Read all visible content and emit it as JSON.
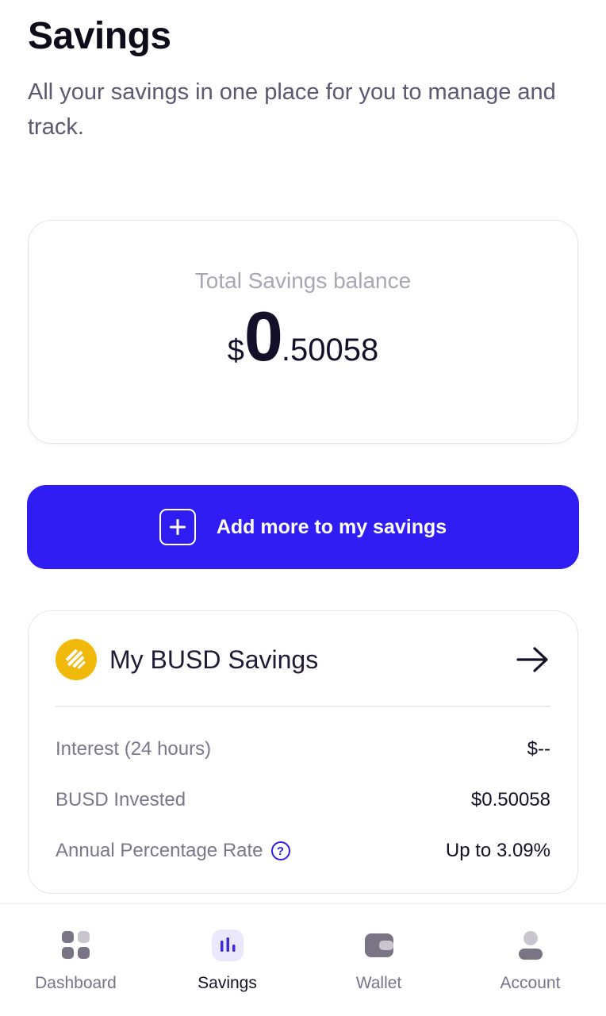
{
  "header": {
    "title": "Savings",
    "subtitle": "All your savings in one place for you to manage and track."
  },
  "balance": {
    "label": "Total Savings balance",
    "currency": "$",
    "whole": "0",
    "fraction": ".50058"
  },
  "add_button": {
    "label": "Add more to my savings",
    "icon": "plus-square-icon"
  },
  "busd_savings": {
    "title": "My BUSD Savings",
    "icon": "busd-coin-icon",
    "rows": [
      {
        "label": "Interest (24 hours)",
        "value": "$--"
      },
      {
        "label": "BUSD Invested",
        "value": "$0.50058"
      },
      {
        "label": "Annual Percentage Rate",
        "value": "Up to 3.09%",
        "help_icon": "?"
      }
    ]
  },
  "nav": {
    "items": [
      {
        "label": "Dashboard",
        "icon": "dashboard-grid-icon",
        "active": false
      },
      {
        "label": "Savings",
        "icon": "savings-chart-icon",
        "active": true
      },
      {
        "label": "Wallet",
        "icon": "wallet-icon",
        "active": false
      },
      {
        "label": "Account",
        "icon": "account-user-icon",
        "active": false
      }
    ]
  },
  "colors": {
    "primary": "#2f1df3",
    "busd": "#f0b90b",
    "text_dark": "#14102a",
    "text_muted": "#7b778a"
  }
}
